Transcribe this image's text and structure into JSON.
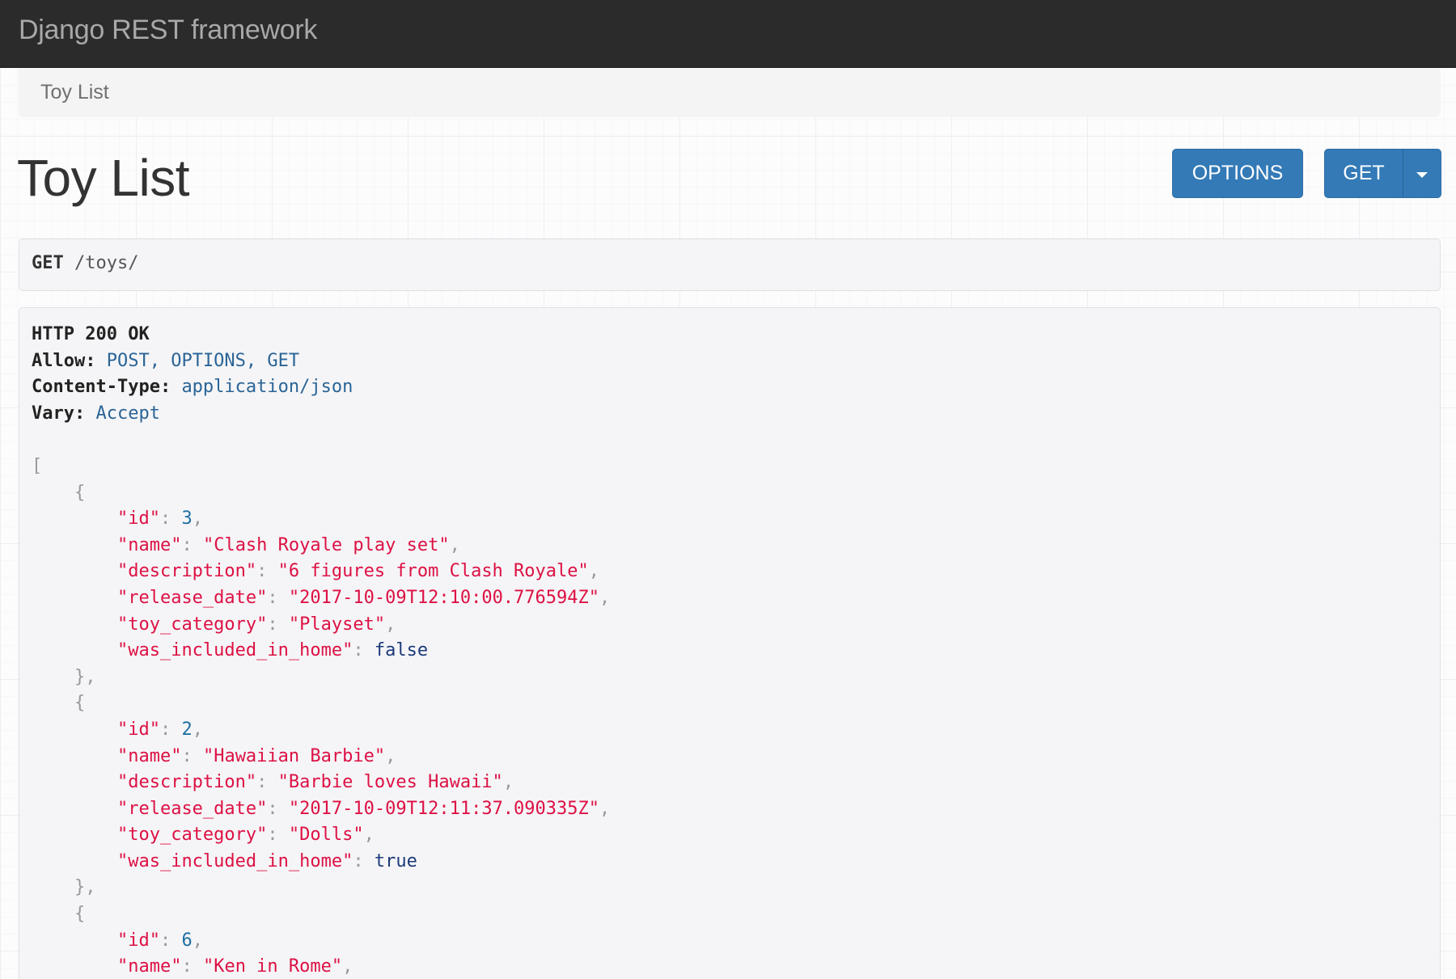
{
  "navbar": {
    "brand": "Django REST framework"
  },
  "breadcrumb": {
    "items": [
      "Toy List"
    ]
  },
  "page": {
    "title": "Toy List"
  },
  "buttons": {
    "options_label": "OPTIONS",
    "get_label": "GET"
  },
  "request": {
    "method": "GET",
    "path": "/toys/"
  },
  "response": {
    "status": "HTTP 200 OK",
    "headers": [
      {
        "name": "Allow:",
        "value": "POST, OPTIONS, GET"
      },
      {
        "name": "Content-Type:",
        "value": "application/json"
      },
      {
        "name": "Vary:",
        "value": "Accept"
      }
    ],
    "items": [
      {
        "id": "3",
        "name": "\"Clash Royale play set\"",
        "description": "\"6 figures from Clash Royale\"",
        "release_date": "\"2017-10-09T12:10:00.776594Z\"",
        "toy_category": "\"Playset\"",
        "was_included_in_home": "false"
      },
      {
        "id": "2",
        "name": "\"Hawaiian Barbie\"",
        "description": "\"Barbie loves Hawaii\"",
        "release_date": "\"2017-10-09T12:11:37.090335Z\"",
        "toy_category": "\"Dolls\"",
        "was_included_in_home": "true"
      },
      {
        "id": "6",
        "name": "\"Ken in Rome\""
      }
    ],
    "keys": {
      "id": "\"id\"",
      "name": "\"name\"",
      "description": "\"description\"",
      "release_date": "\"release_date\"",
      "toy_category": "\"toy_category\"",
      "was_included_in_home": "\"was_included_in_home\""
    }
  }
}
